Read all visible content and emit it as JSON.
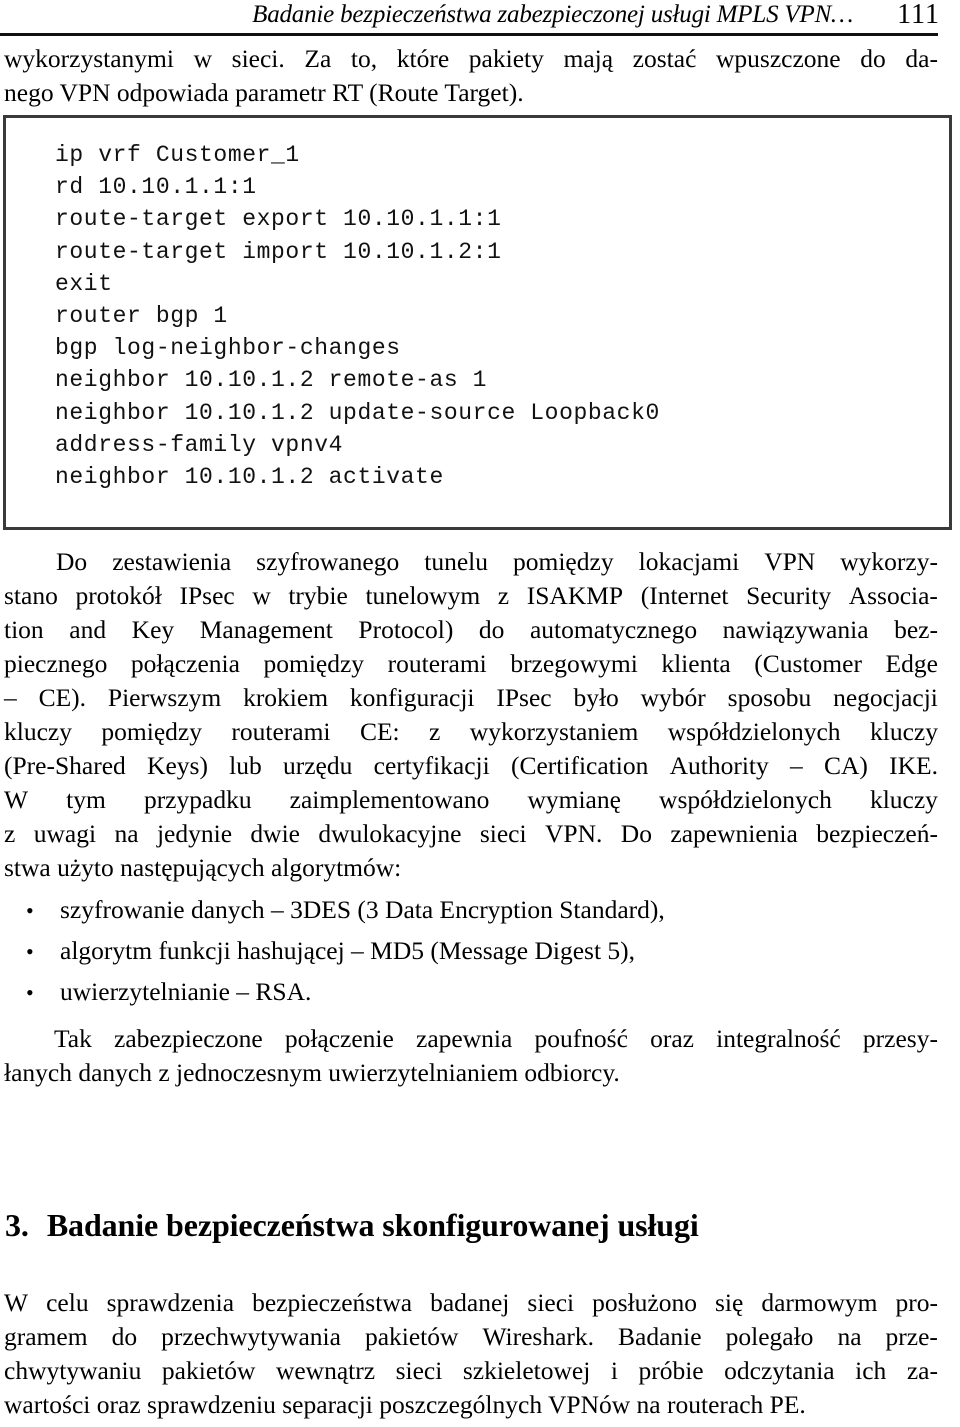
{
  "header": {
    "running_title": "Badanie bezpieczeństwa zabezpieczonej usługi MPLS VPN…",
    "page_number": "111"
  },
  "paragraphs": {
    "top": {
      "lines": [
        [
          "wykorzystanymi",
          "w",
          "sieci.",
          "Za",
          "to,",
          "które",
          "pakiety",
          "mają",
          "zostać",
          "wpuszczone",
          "do",
          "da-"
        ],
        [
          "nego VPN odpowiada parametr RT (Route Target)."
        ]
      ]
    },
    "after_code": {
      "lines": [
        [
          "Do",
          "zestawienia",
          "szyfrowanego",
          "tunelu",
          "pomiędzy",
          "lokacjami",
          "VPN",
          "wykorzy-"
        ],
        [
          "stano",
          "protokół",
          "IPsec",
          "w",
          "trybie",
          "tunelowym",
          "z",
          "ISAKMP",
          "(Internet",
          "Security",
          "Associa-"
        ],
        [
          "tion",
          "and",
          "Key",
          "Management",
          "Protocol)",
          "do",
          "automatycznego",
          "nawiązywania",
          "bez-"
        ],
        [
          "piecznego",
          "połączenia",
          "pomiędzy",
          "routerami",
          "brzegowymi",
          "klienta",
          "(Customer",
          "Edge"
        ],
        [
          "–",
          "CE).",
          "Pierwszym",
          "krokiem",
          "konfiguracji",
          "IPsec",
          "było",
          "wybór",
          "sposobu",
          "negocjacji"
        ],
        [
          "kluczy",
          "pomiędzy",
          "routerami",
          "CE:",
          "z",
          "wykorzystaniem",
          "współdzielonych",
          "kluczy"
        ],
        [
          "(Pre-Shared",
          "Keys)",
          "lub",
          "urzędu",
          "certyfikacji",
          "(Certification",
          "Authority",
          "–",
          "CA)",
          "IKE."
        ],
        [
          "W",
          "tym",
          "przypadku",
          "zaimplementowano",
          "wymianę",
          "współdzielonych",
          "kluczy"
        ],
        [
          "z",
          "uwagi",
          "na",
          "jedynie",
          "dwie",
          "dwulokacyjne",
          "sieci",
          "VPN.",
          "Do",
          "zapewnienia",
          "bezpieczeń-"
        ],
        [
          "stwa użyto następujących algorytmów:"
        ]
      ]
    },
    "after_bullets": {
      "lines": [
        [
          "Tak",
          "zabezpieczone",
          "połączenie",
          "zapewnia",
          "poufność",
          "oraz",
          "integralność",
          "przesy-"
        ],
        [
          "łanych danych z jednoczesnym uwierzytelnianiem odbiorcy."
        ]
      ]
    },
    "last": {
      "lines": [
        [
          "W",
          "celu",
          "sprawdzenia",
          "bezpieczeństwa",
          "badanej",
          "sieci",
          "posłużono",
          "się",
          "darmowym",
          "pro-"
        ],
        [
          "gramem",
          "do",
          "przechwytywania",
          "pakietów",
          "Wireshark.",
          "Badanie",
          "polegało",
          "na",
          "prze-"
        ],
        [
          "chwytywaniu",
          "pakietów",
          "wewnątrz",
          "sieci",
          "szkieletowej",
          "i",
          "próbie",
          "odczytania",
          "ich",
          "za-"
        ],
        [
          "wartości oraz sprawdzeniu separacji poszczególnych VPNów na routerach PE."
        ]
      ]
    }
  },
  "code_block": {
    "lines": [
      "ip vrf Customer_1",
      "rd 10.10.1.1:1",
      "route-target export 10.10.1.1:1",
      "route-target import 10.10.1.2:1",
      "exit",
      "router bgp 1",
      "bgp log-neighbor-changes",
      "neighbor 10.10.1.2 remote-as 1",
      "neighbor 10.10.1.2 update-source Loopback0",
      "address-family vpnv4",
      "neighbor 10.10.1.2 activate"
    ]
  },
  "bullet_list": {
    "marker": "•",
    "items": [
      "szyfrowanie danych – 3DES (3 Data Encryption Standard),",
      "algorytm funkcji hashującej – MD5 (Message Digest 5),",
      "uwierzytelnianie – RSA."
    ]
  },
  "section_heading": {
    "number": "3.",
    "title": "Badanie bezpieczeństwa skonfigurowanej usługi"
  },
  "colors": {
    "text": "#000000",
    "rule": "#111111",
    "code_border": "#3a3a3a",
    "page_background": "#ffffff"
  }
}
